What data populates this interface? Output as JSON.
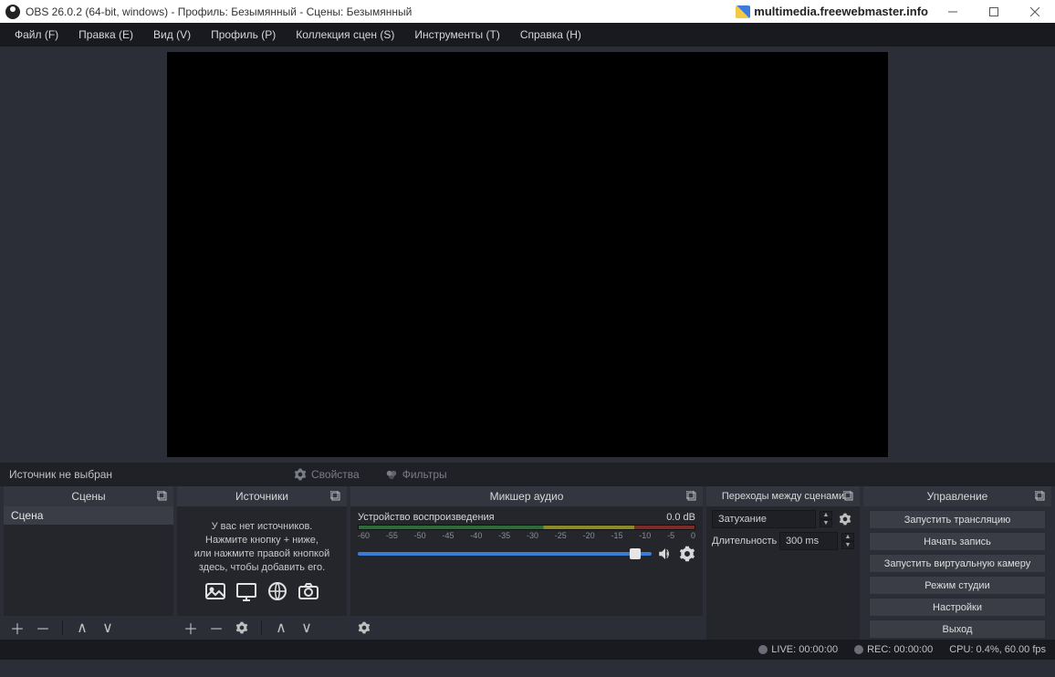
{
  "titlebar": {
    "title": "OBS 26.0.2 (64-bit, windows) - Профиль: Безымянный - Сцены: Безымянный",
    "watermark": "multimedia.freewebmaster.info"
  },
  "menubar": {
    "items": [
      "Файл (F)",
      "Правка (E)",
      "Вид (V)",
      "Профиль (P)",
      "Коллекция сцен (S)",
      "Инструменты (T)",
      "Справка (H)"
    ]
  },
  "sourceinfo": {
    "selected": "Источник не выбран",
    "properties": "Свойства",
    "filters": "Фильтры"
  },
  "docks": {
    "scenes": {
      "title": "Сцены",
      "item": "Сцена"
    },
    "sources": {
      "title": "Источники",
      "empty_l1": "У вас нет источников.",
      "empty_l2": "Нажмите кнопку + ниже,",
      "empty_l3": "или нажмите правой кнопкой",
      "empty_l4": "здесь, чтобы добавить его."
    },
    "mixer": {
      "title": "Микшер аудио",
      "device": "Устройство воспроизведения",
      "level": "0.0 dB",
      "ticks": [
        "-60",
        "-55",
        "-50",
        "-45",
        "-40",
        "-35",
        "-30",
        "-25",
        "-20",
        "-15",
        "-10",
        "-5",
        "0"
      ]
    },
    "transitions": {
      "title": "Переходы между сценами",
      "mode": "Затухание",
      "duration_label": "Длительность",
      "duration_value": "300 ms"
    },
    "controls": {
      "title": "Управление",
      "buttons": [
        "Запустить трансляцию",
        "Начать запись",
        "Запустить виртуальную камеру",
        "Режим студии",
        "Настройки",
        "Выход"
      ]
    }
  },
  "statusbar": {
    "live": "LIVE: 00:00:00",
    "rec": "REC: 00:00:00",
    "cpu": "CPU: 0.4%, 60.00 fps"
  }
}
